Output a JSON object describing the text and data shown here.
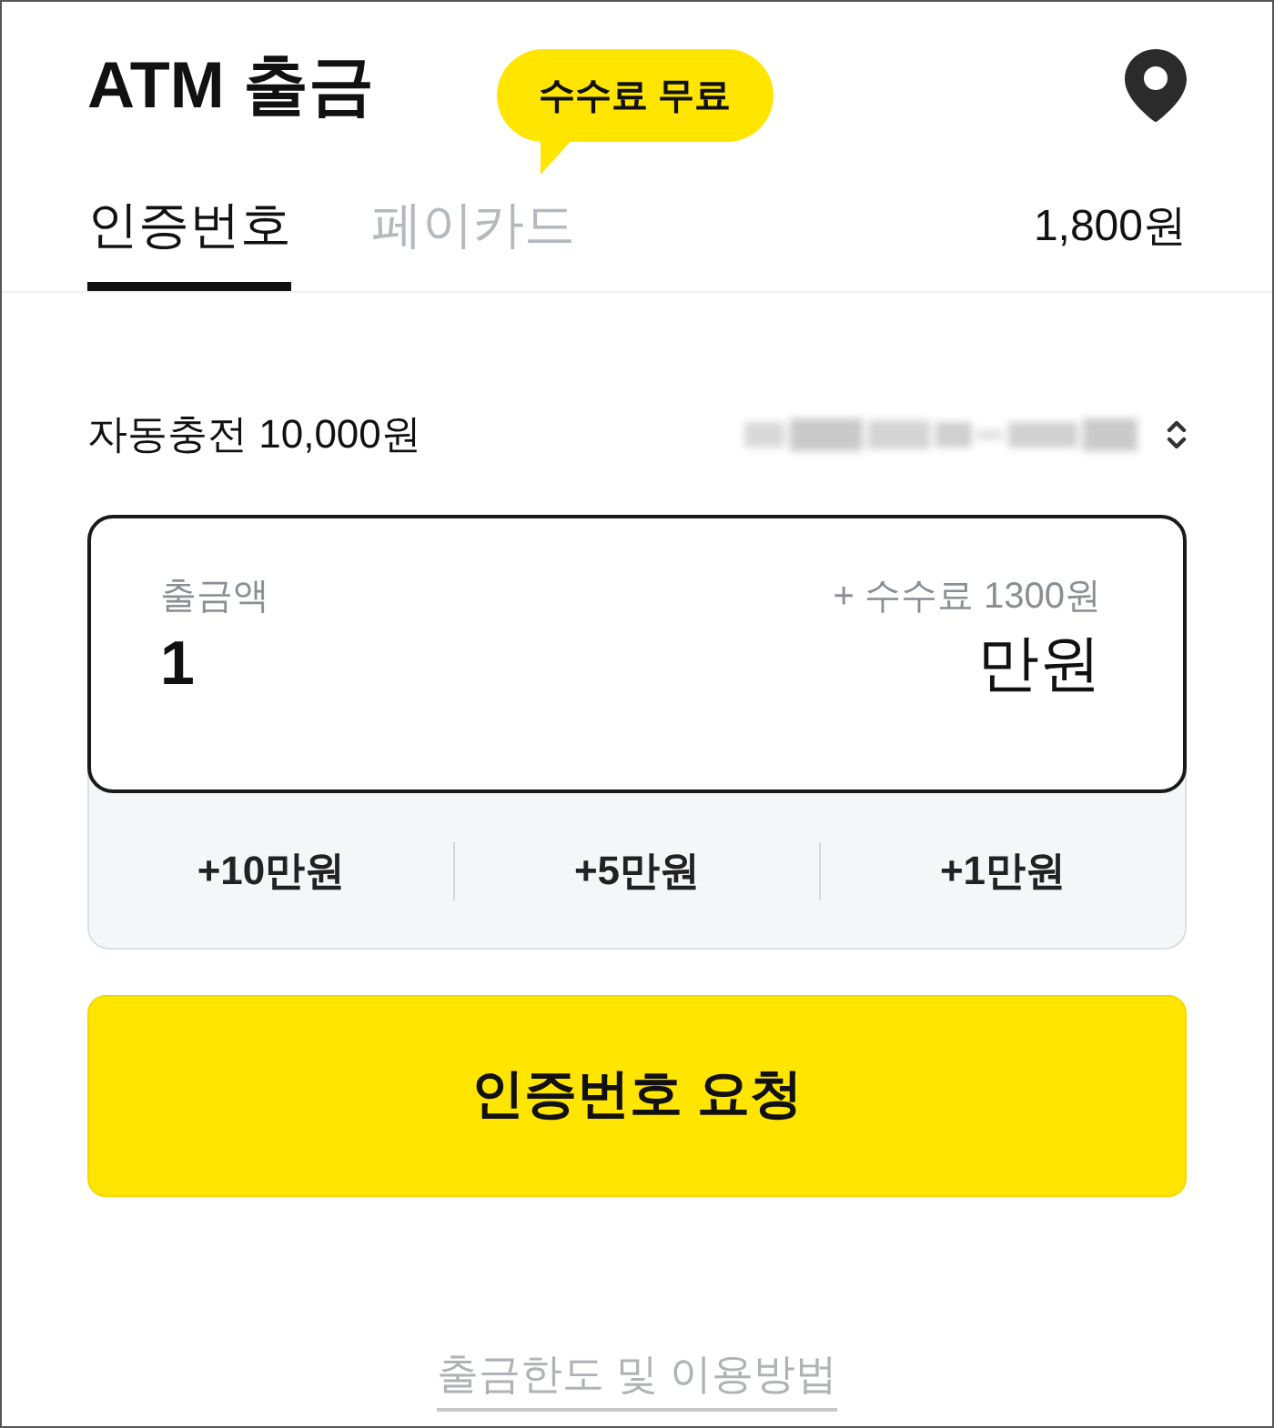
{
  "header": {
    "title": "ATM 출금",
    "badge": "수수료 무료"
  },
  "tabs": [
    {
      "label": "인증번호",
      "selected": true
    },
    {
      "label": "페이카드",
      "selected": false
    }
  ],
  "balance": "1,800원",
  "auto_charge": {
    "label": "자동충전 10,000원"
  },
  "amount": {
    "label": "출금액",
    "fee": "+ 수수료 1300원",
    "value": "1",
    "unit": "만원"
  },
  "quick_add": [
    "+10만원",
    "+5만원",
    "+1만원"
  ],
  "submit_button": "인증번호 요청",
  "footer_link": "출금한도 및 이용방법"
}
